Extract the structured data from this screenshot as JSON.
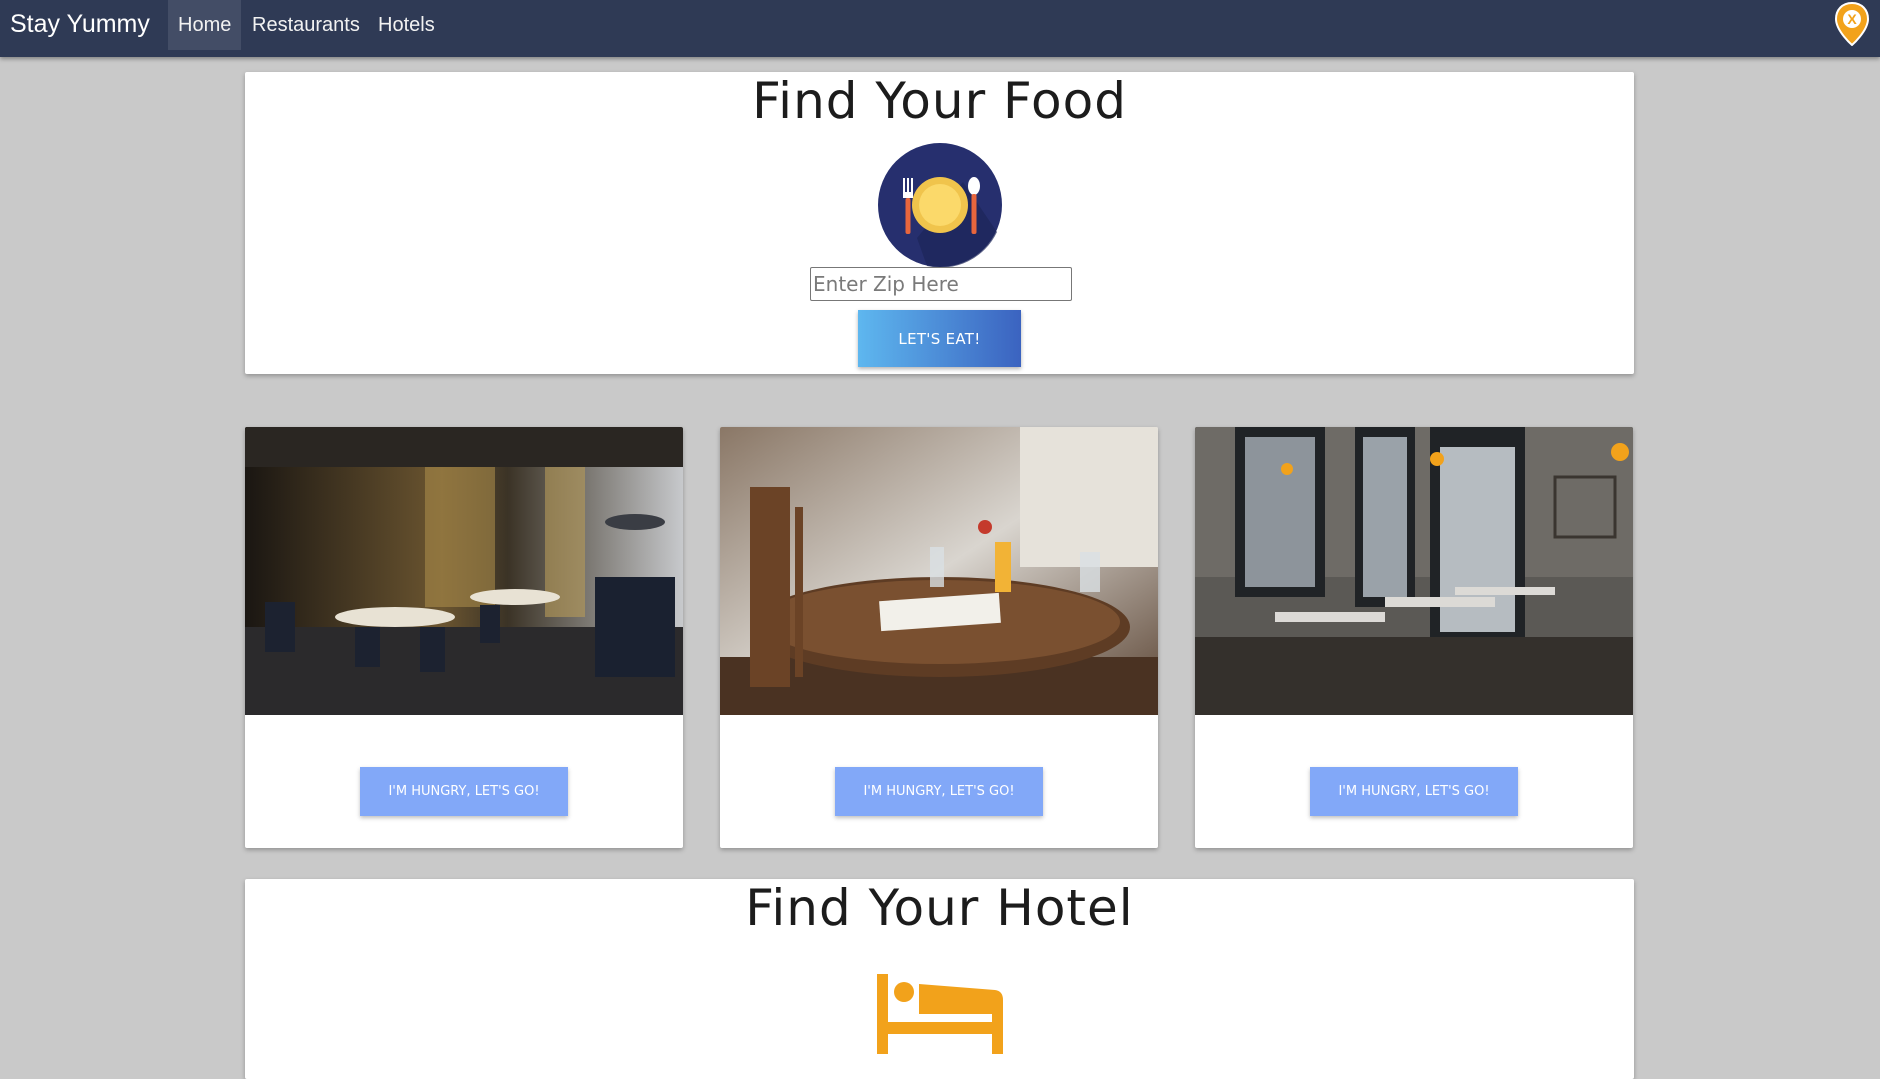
{
  "navbar": {
    "brand": "Stay Yummy",
    "links": [
      {
        "label": "Home",
        "active": true
      },
      {
        "label": "Restaurants",
        "active": false
      },
      {
        "label": "Hotels",
        "active": false
      }
    ],
    "logo_icon": "stay-yummy-pin-logo",
    "background": "#2f3a55"
  },
  "food_section": {
    "title": "Find Your Food",
    "icon": "plate-fork-spoon-icon",
    "zip_placeholder": "Enter Zip Here",
    "zip_value": "",
    "submit_label": "LET'S EAT!"
  },
  "restaurants": [
    {
      "image": "restaurant-interior-photo",
      "button_label": "I'M HUNGRY, LET'S GO!"
    },
    {
      "image": "restaurant-table-photo",
      "button_label": "I'M HUNGRY, LET'S GO!"
    },
    {
      "image": "bistro-interior-photo",
      "button_label": "I'M HUNGRY, LET'S GO!"
    }
  ],
  "hotel_section": {
    "title": "Find Your Hotel",
    "icon": "bed-icon"
  },
  "colors": {
    "accent_button": "#82a8f8",
    "gradient_start": "#5eb7ef",
    "gradient_end": "#3b63c0",
    "bed_icon": "#f2a21b",
    "plate_bg": "#262f6e"
  }
}
